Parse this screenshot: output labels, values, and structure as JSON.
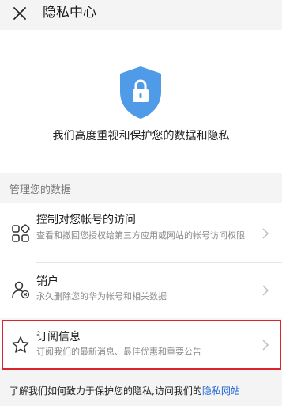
{
  "header": {
    "close_icon": "close-icon",
    "title": "隐私中心"
  },
  "hero": {
    "icon": "shield-lock-icon",
    "accent_color": "#4f9be8",
    "text": "我们高度重视和保护您的数据和隐私"
  },
  "section": {
    "label": "管理您的数据"
  },
  "rows": [
    {
      "icon": "apps-grid-icon",
      "title": "控制对您帐号的访问",
      "description": "查看和撤回您授权给第三方应用或网站的帐号访问权限"
    },
    {
      "icon": "user-remove-icon",
      "title": "销户",
      "description": "永久删除您的华为帐号和相关数据"
    },
    {
      "icon": "star-icon",
      "title": "订阅信息",
      "description": "订阅我们的最新消息、最佳优惠和重要公告",
      "highlighted": true
    }
  ],
  "highlight_color": "#d9232d",
  "footer": {
    "text": "了解我们如何致力于保护您的隐私,访问我们的",
    "link_text": "隐私网站",
    "link_color": "#1a5fd6"
  }
}
